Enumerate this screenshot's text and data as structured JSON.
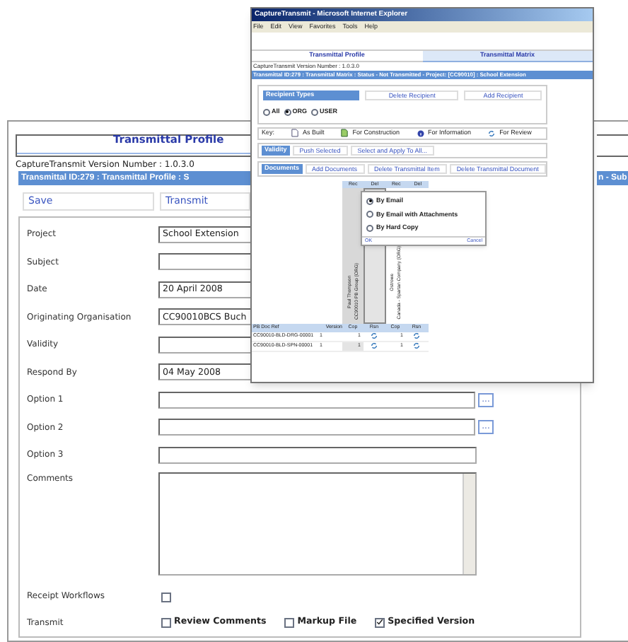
{
  "back_window": {
    "title": "Transmittal Profile",
    "version": "CaptureTransmit Version Number : 1.0.3.0",
    "breadcrumb_left": "Transmittal ID:279 : Transmittal Profile : S",
    "breadcrumb_right": "n - Sub",
    "toolbar": [
      "Save",
      "Transmit"
    ],
    "fields": [
      {
        "label": "Project",
        "kind": "text",
        "value": "School Extension"
      },
      {
        "label": "Subject",
        "kind": "text"
      },
      {
        "label": "Date",
        "kind": "text",
        "value": "20 April 2008"
      },
      {
        "label": "Originating Organisation",
        "kind": "text",
        "value": "CC90010BCS Buch"
      },
      {
        "label": "Validity",
        "kind": "text"
      },
      {
        "label": "Respond By",
        "kind": "text",
        "value": "04 May 2008"
      },
      {
        "label": "Option 1",
        "kind": "lookup",
        "button": "..."
      },
      {
        "label": "Option 2",
        "kind": "lookup",
        "button": "..."
      },
      {
        "label": "Option 3",
        "kind": "wide"
      },
      {
        "label": "Comments",
        "kind": "textarea"
      },
      {
        "label": "Receipt Workflows",
        "kind": "checkbox",
        "checked": false
      },
      {
        "label": "Transmit",
        "kind": "checks",
        "options": [
          {
            "label": "Review Comments",
            "checked": false
          },
          {
            "label": "Markup File",
            "checked": false
          },
          {
            "label": "Specified Version",
            "checked": true
          }
        ]
      }
    ]
  },
  "front_window": {
    "title": "CaptureTransmit - Microsoft Internet Explorer",
    "menu": [
      "File",
      "Edit",
      "View",
      "Favorites",
      "Tools",
      "Help"
    ],
    "tabs": [
      {
        "label": "Transmittal Profile",
        "selected": false
      },
      {
        "label": "Transmittal Matrix",
        "selected": true
      }
    ],
    "version": "CaptureTransmit Version Number : 1.0.3.0",
    "breadcrumb": "Transmittal ID:279 : Transmittal Matrix : Status - Not Transmitted - Project: [CC90010] : School Extension",
    "recipients": {
      "title": "Recipient Types",
      "actions": [
        "Delete Recipient",
        "Add Recipient"
      ],
      "radios": [
        {
          "label": "All",
          "selected": false
        },
        {
          "label": "ORG",
          "selected": true
        },
        {
          "label": "USER",
          "selected": false
        }
      ]
    },
    "key": {
      "label": "Key:",
      "items": [
        {
          "label": "As Built",
          "kind": "doc"
        },
        {
          "label": "For Construction",
          "kind": "doc-green"
        },
        {
          "label": "For Information",
          "kind": "info"
        },
        {
          "label": "For Review",
          "kind": "review"
        }
      ]
    },
    "validity": {
      "label": "Validity",
      "actions": [
        "Push Selected",
        "Select and Apply To All..."
      ]
    },
    "documents": {
      "label": "Documents",
      "actions": [
        "Add Documents",
        "Delete Transmittal Item",
        "Delete Transmittal Document"
      ]
    },
    "matrix": {
      "top_headers": [
        "Rec",
        "Del",
        "Rec",
        "Del"
      ],
      "recipients": [
        {
          "lines": [
            "Paul Thompson",
            "CC90010 PB Group (ORG)"
          ]
        },
        {
          "lines": [
            "Ostrowe",
            "Canada - Spartan Company (ORG)"
          ]
        }
      ],
      "columns": [
        "PB Doc Ref",
        "Version",
        "Cop",
        "Rsn",
        "Cop",
        "Rsn"
      ],
      "rows": [
        {
          "ref": "CC90010-BLD-DRG-00001",
          "version": "1",
          "cop_1": "1",
          "cop_2": "1"
        },
        {
          "ref": "CC90010-BLD-SPN-00001",
          "version": "1",
          "cop_1": "1",
          "cop_2": "1"
        }
      ]
    },
    "popup": {
      "options": [
        {
          "label": "By Email",
          "selected": true
        },
        {
          "label": "By Email with Attachments",
          "selected": false
        },
        {
          "label": "By Hard Copy",
          "selected": false
        }
      ],
      "ok": "OK",
      "cancel": "Cancel"
    }
  }
}
